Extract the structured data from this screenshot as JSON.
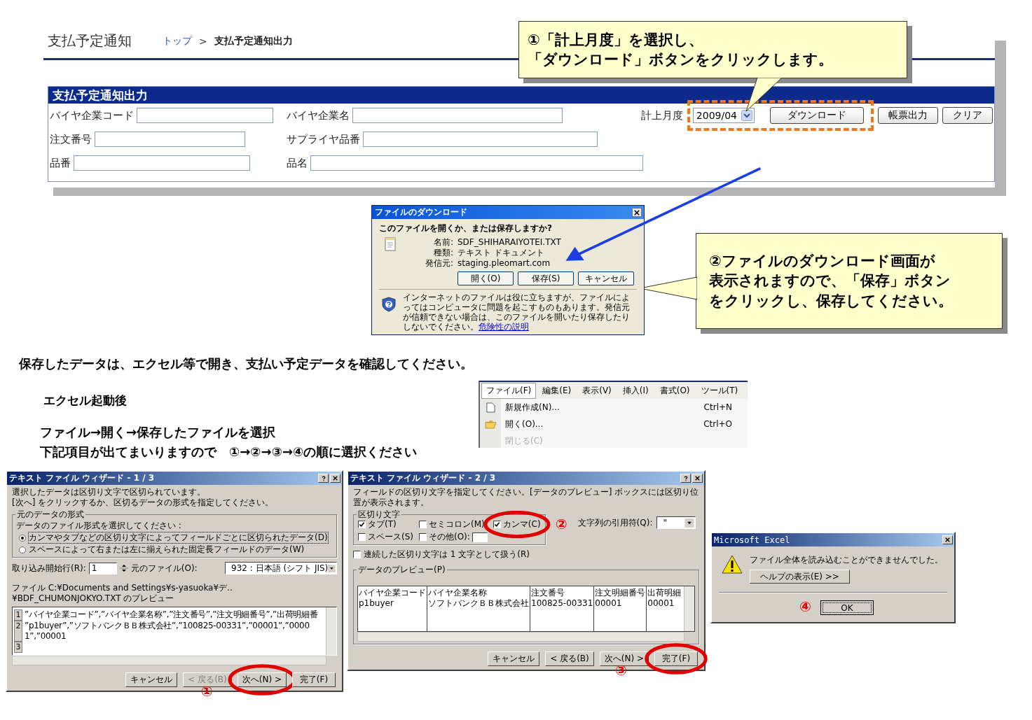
{
  "header": {
    "title": "支払予定通知",
    "breadcrumb": [
      {
        "kind": "link",
        "label": "トップ"
      },
      {
        "kind": "separator",
        "label": ">"
      },
      {
        "kind": "current",
        "label": "支払予定通知出力"
      }
    ]
  },
  "form": {
    "title": "支払予定通知出力",
    "rows": [
      [
        {
          "label": "バイヤ企業コード"
        },
        {
          "label": "バイヤ企業名"
        }
      ],
      [
        {
          "label": "注文番号"
        },
        {
          "label": "サプライヤ品番"
        }
      ],
      [
        {
          "label": "品番"
        },
        {
          "label": "品名"
        }
      ]
    ],
    "month": {
      "label": "計上月度",
      "value": "2009/04"
    },
    "buttons": [
      "ダウンロード",
      "帳票出力",
      "クリア"
    ]
  },
  "callouts": [
    {
      "lines": [
        "①「計上月度」を選択し、",
        "「ダウンロード」ボタンをクリックします。"
      ]
    },
    {
      "lines": [
        "②ファイルのダウンロード画面が",
        "表示されますので、「保存」ボタン",
        "をクリックし、保存してください。"
      ]
    }
  ],
  "download_dialog": {
    "title": "ファイルのダウンロード",
    "question": "このファイルを開くか、または保存しますか?",
    "details": [
      {
        "label": "名前:",
        "value": "SDF_SHIHARAIYOTEI.TXT"
      },
      {
        "label": "種類:",
        "value": "テキスト ドキュメント"
      },
      {
        "label": "発信元:",
        "value": "staging.pleomart.com"
      }
    ],
    "buttons": [
      "開く(O)",
      "保存(S)",
      "キャンセル"
    ],
    "warning": "インターネットのファイルは役に立ちますが、ファイルによってはコンピュータに問題を起こすものもあります。発信元が信頼できない場合は、このファイルを開いたり保存したりしないでください。",
    "link": "危険性の説明"
  },
  "instructions": [
    "保存したデータは、エクセル等で開き、支払い予定データを確認してください。",
    "エクセル起動後",
    "ファイル→開く→保存したファイルを選択",
    "下記項目が出てまいりますので　①→②→③→④の順に選択ください"
  ],
  "menu": {
    "bar": [
      {
        "label": "ファイル(F)",
        "selected": true
      },
      {
        "label": "編集(E)",
        "selected": false
      },
      {
        "label": "表示(V)",
        "selected": false
      },
      {
        "label": "挿入(I)",
        "selected": false
      },
      {
        "label": "書式(O)",
        "selected": false
      },
      {
        "label": "ツール(T)",
        "selected": false
      }
    ],
    "items": [
      {
        "label": "新規作成(N)...",
        "shortcut": "Ctrl+N",
        "disabled": false
      },
      {
        "label": "開く(O)...",
        "shortcut": "Ctrl+O",
        "disabled": false
      },
      {
        "label": "閉じる(C)",
        "disabled": true
      }
    ]
  },
  "wizard1": {
    "title": "テキスト ファイル ウィザード - 1 / 3",
    "description": [
      "選択したデータは区切り文字で区切られています。",
      "[次へ] をクリックするか、区切るデータの形式を指定してください。"
    ],
    "group_label": "元のデータの形式",
    "prompt": "データのファイル形式を選択してください :",
    "options": [
      {
        "label": "カンマやタブなどの区切り文字によってフィールドごとに区切られたデータ(D)",
        "selected": true
      },
      {
        "label": "スペースによって右または左に揃えられた固定長フィールドのデータ(W)",
        "selected": false
      }
    ],
    "start_row": {
      "label": "取り込み開始行(R):",
      "value": "1"
    },
    "origin": {
      "label": "元のファイル(O):",
      "value": "932 : 日本語 (シフト JIS)"
    },
    "preview_label": "ファイル C:¥Documents and Settings¥s-yasuoka¥デ..¥BDF_CHUMONJOKYO.TXT のプレビュー",
    "preview_rows": [
      {
        "num": "1",
        "text": "”バイヤ企業コード”,”バイヤ企業名称”,”注文番号”,”注文明細番号”,”出荷明細番"
      },
      {
        "num": "2",
        "text": "”p1buyer”,”ソフトバンクＢＢ株式会社”,”100825-00331”,”00001”,”00001”,”00001"
      },
      {
        "num": "3"
      }
    ],
    "buttons": [
      {
        "label": "キャンセル",
        "disabled": false
      },
      {
        "label": "< 戻る(B)",
        "disabled": true
      },
      {
        "label": "次へ(N) >",
        "disabled": false,
        "step": "①"
      },
      {
        "label": "完了(F)",
        "disabled": false
      }
    ]
  },
  "wizard2": {
    "title": "テキスト ファイル ウィザード - 2 / 3",
    "description": "フィールドの区切り文字を指定してください。[データのプレビュー] ボックスには区切り位置が表示されます。",
    "group_label": "区切り文字",
    "delimiters": [
      {
        "label": "タブ(T)",
        "checked": true
      },
      {
        "label": "セミコロン(M)",
        "checked": false
      },
      {
        "label": "カンマ(C)",
        "checked": true,
        "step": "②"
      },
      {
        "label": "スペース(S)",
        "checked": false
      },
      {
        "label": "その他(O):",
        "checked": false
      }
    ],
    "quote": {
      "label": "文字列の引用符(Q):",
      "value": "\""
    },
    "consecutive": {
      "label": "連続した区切り文字は 1 文字として扱う(R)",
      "checked": false
    },
    "preview_label": "データのプレビュー(P)",
    "columns": [
      {
        "header": "バイヤ企業コード",
        "value": "p1buyer"
      },
      {
        "header": "バイヤ企業名称",
        "value": "ソフトバンクＢＢ株式会社"
      },
      {
        "header": "注文番号",
        "value": "100825-00331"
      },
      {
        "header": "注文明細番号",
        "value": "00001"
      },
      {
        "header": "出荷明細",
        "value": "00001"
      }
    ],
    "buttons": [
      {
        "label": "キャンセル",
        "disabled": false
      },
      {
        "label": "< 戻る(B)",
        "disabled": false
      },
      {
        "label": "次へ(N) >",
        "disabled": false
      },
      {
        "label": "完了(F)",
        "disabled": false,
        "step": "③"
      }
    ]
  },
  "excel_alert": {
    "title": "Microsoft Excel",
    "message": "ファイル全体を読み込むことができませんでした。",
    "help_button": "ヘルプの表示(E) >>",
    "ok_button": "OK",
    "step": "④"
  }
}
